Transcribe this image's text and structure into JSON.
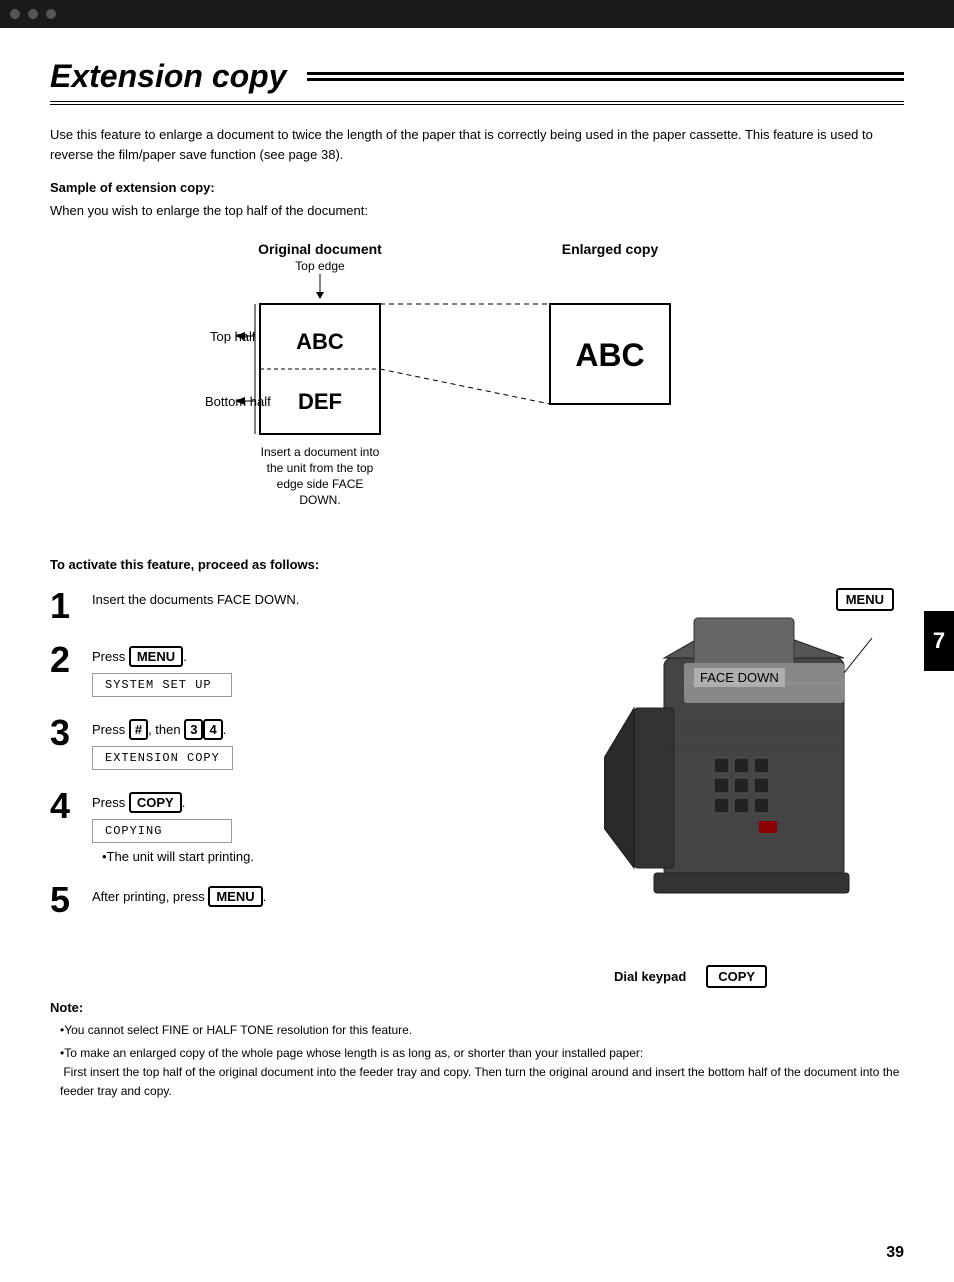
{
  "topbar": {
    "label": "top navigation bar"
  },
  "title": "Extension copy",
  "intro": "Use this feature to enlarge a document to twice the length of the paper that is correctly being used in the paper cassette. This feature is used to reverse the film/paper save function (see page 38).",
  "sample_header": "Sample of extension copy:",
  "sample_sub": "When you wish to enlarge the top half of the document:",
  "diagram": {
    "original_label": "Original document",
    "top_edge_label": "Top edge",
    "top_half_label": "Top half",
    "bottom_half_label": "Bottom half",
    "abc_text": "ABC",
    "def_text": "DEF",
    "enlarged_label": "Enlarged copy",
    "enlarged_abc": "ABC",
    "insert_instruction": "Insert a document into the unit from the top edge side FACE DOWN."
  },
  "steps_header": "To activate this feature, proceed as follows:",
  "steps": [
    {
      "number": "1",
      "text": "Insert the documents FACE DOWN.",
      "display": null,
      "key": null
    },
    {
      "number": "2",
      "text": "Press ",
      "key": "MENU",
      "display": "SYSTEM SET UP"
    },
    {
      "number": "3",
      "text": "Press ",
      "hash": "#",
      "then_text": ", then ",
      "key2": "3",
      "key3": "4",
      "display": "EXTENSION COPY"
    },
    {
      "number": "4",
      "text": "Press ",
      "key": "COPY",
      "display": "COPYING",
      "bullet": "•The unit will start printing."
    },
    {
      "number": "5",
      "text": "After printing, press ",
      "key": "MENU",
      "display": null
    }
  ],
  "printer": {
    "menu_label": "MENU",
    "face_down_label": "FACE DOWN",
    "dial_keypad_label": "Dial keypad",
    "copy_button_label": "COPY"
  },
  "note": {
    "header": "Note:",
    "bullets": [
      "•You cannot select FINE or HALF TONE resolution for this feature.",
      "•To make an enlarged copy of the whole page whose length is as long as, or shorter than your installed paper: First insert the top half of the original document into the feeder tray and copy. Then turn the original around and insert the bottom half of the document into the feeder tray and copy."
    ]
  },
  "page_number": "39",
  "chapter_number": "7"
}
